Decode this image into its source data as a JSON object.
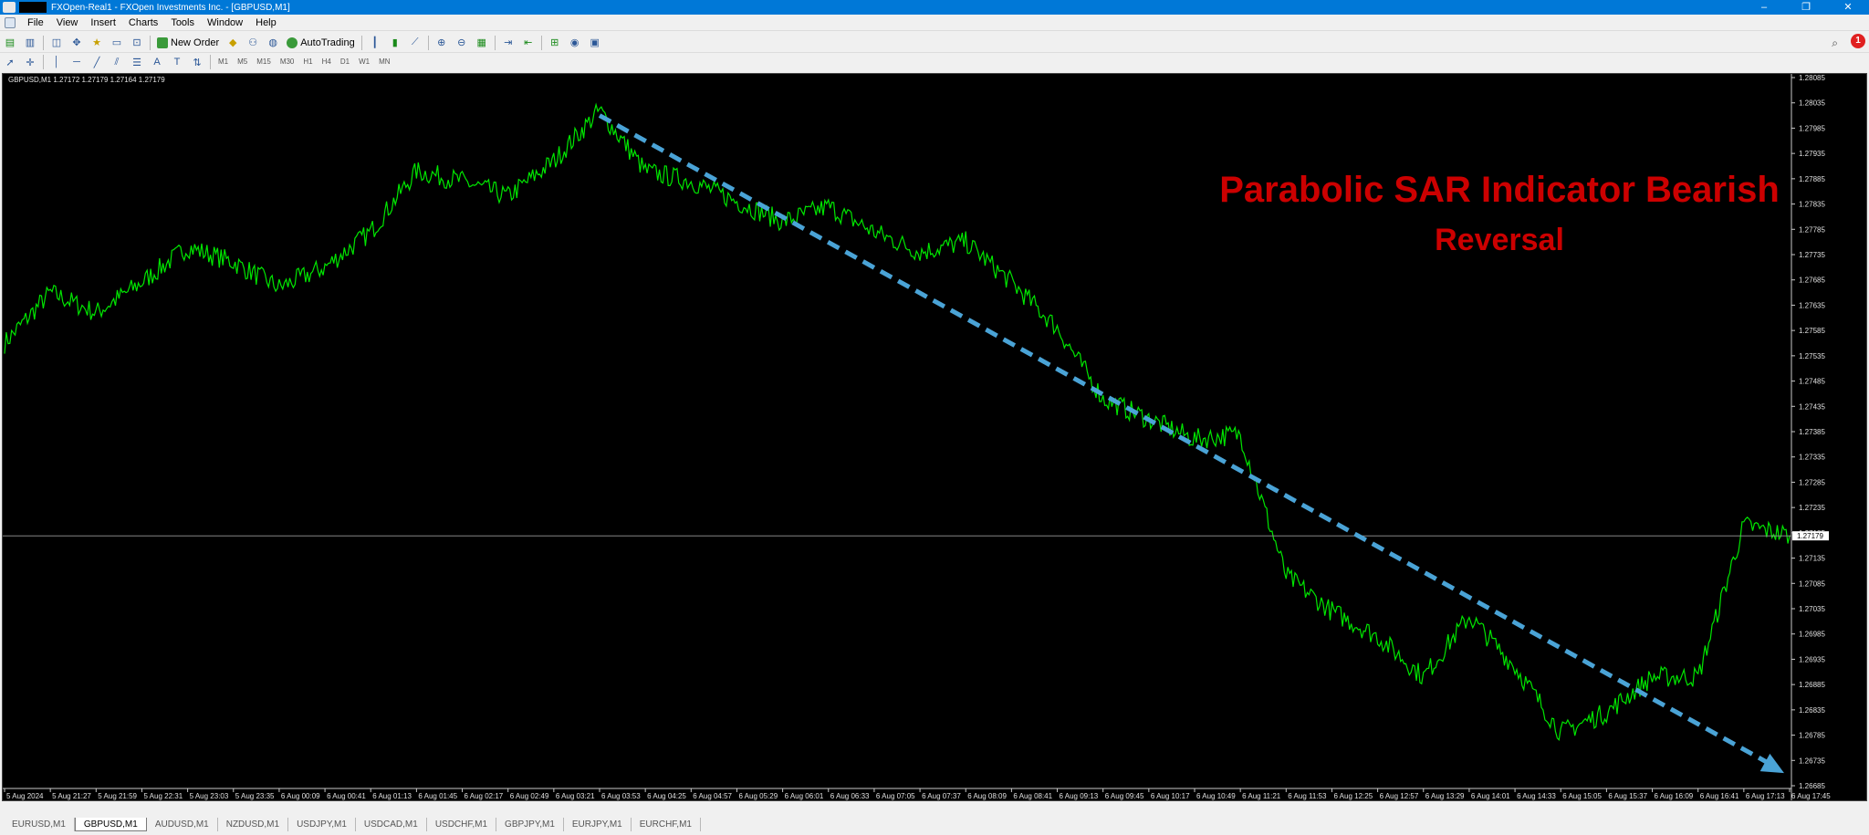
{
  "window": {
    "title": "FXOpen-Real1 - FXOpen Investments Inc. - [GBPUSD,M1]",
    "controls": [
      "–",
      "❐",
      "✕"
    ]
  },
  "menu": [
    "File",
    "View",
    "Insert",
    "Charts",
    "Tools",
    "Window",
    "Help"
  ],
  "toolbar": {
    "new_order_label": "New Order",
    "autotrading_label": "AutoTrading"
  },
  "timeframes": [
    "M1",
    "M5",
    "M15",
    "M30",
    "H1",
    "H4",
    "D1",
    "W1",
    "MN"
  ],
  "notifications": {
    "count": "1"
  },
  "chart": {
    "header": "GBPUSD,M1  1.27172 1.27179 1.27164 1.27179",
    "annotation_line1": "Parabolic SAR Indicator Bearish",
    "annotation_line2": "Reversal",
    "current_price": "1.27179",
    "colors": {
      "price_line": "#00e600",
      "trend_arrow": "#4aa3d6",
      "annotation": "#cc0000",
      "background": "#000000"
    },
    "price_ticks": [
      "1.28085",
      "1.28035",
      "1.27985",
      "1.27935",
      "1.27885",
      "1.27835",
      "1.27785",
      "1.27735",
      "1.27685",
      "1.27635",
      "1.27585",
      "1.27535",
      "1.27485",
      "1.27435",
      "1.27385",
      "1.27335",
      "1.27285",
      "1.27235",
      "1.27185",
      "1.27135",
      "1.27085",
      "1.27035",
      "1.26985",
      "1.26935",
      "1.26885",
      "1.26835",
      "1.26785",
      "1.26735",
      "1.26685"
    ],
    "time_ticks": [
      "5 Aug 2024",
      "5 Aug 21:27",
      "5 Aug 21:59",
      "5 Aug 22:31",
      "5 Aug 23:03",
      "5 Aug 23:35",
      "6 Aug 00:09",
      "6 Aug 00:41",
      "6 Aug 01:13",
      "6 Aug 01:45",
      "6 Aug 02:17",
      "6 Aug 02:49",
      "6 Aug 03:21",
      "6 Aug 03:53",
      "6 Aug 04:25",
      "6 Aug 04:57",
      "6 Aug 05:29",
      "6 Aug 06:01",
      "6 Aug 06:33",
      "6 Aug 07:05",
      "6 Aug 07:37",
      "6 Aug 08:09",
      "6 Aug 08:41",
      "6 Aug 09:13",
      "6 Aug 09:45",
      "6 Aug 10:17",
      "6 Aug 10:49",
      "6 Aug 11:21",
      "6 Aug 11:53",
      "6 Aug 12:25",
      "6 Aug 12:57",
      "6 Aug 13:29",
      "6 Aug 14:01",
      "6 Aug 14:33",
      "6 Aug 15:05",
      "6 Aug 15:37",
      "6 Aug 16:09",
      "6 Aug 16:41",
      "6 Aug 17:13",
      "6 Aug 17:45"
    ]
  },
  "chart_data": {
    "type": "line",
    "symbol": "GBPUSD",
    "timeframe": "M1",
    "x": [
      "5 Aug 2024",
      "5 Aug 21:27",
      "5 Aug 21:59",
      "5 Aug 22:31",
      "5 Aug 23:03",
      "5 Aug 23:35",
      "6 Aug 00:09",
      "6 Aug 00:41",
      "6 Aug 01:13",
      "6 Aug 01:45",
      "6 Aug 02:17",
      "6 Aug 02:49",
      "6 Aug 03:21",
      "6 Aug 03:53",
      "6 Aug 04:25",
      "6 Aug 04:57",
      "6 Aug 05:29",
      "6 Aug 06:01",
      "6 Aug 06:33",
      "6 Aug 07:05",
      "6 Aug 07:37",
      "6 Aug 08:09",
      "6 Aug 08:41",
      "6 Aug 09:13",
      "6 Aug 09:45",
      "6 Aug 10:17",
      "6 Aug 10:49",
      "6 Aug 11:21",
      "6 Aug 11:53",
      "6 Aug 12:25",
      "6 Aug 12:57",
      "6 Aug 13:29",
      "6 Aug 14:01",
      "6 Aug 14:33",
      "6 Aug 15:05",
      "6 Aug 15:37",
      "6 Aug 16:09",
      "6 Aug 16:41",
      "6 Aug 17:13",
      "6 Aug 17:45"
    ],
    "series": [
      {
        "values": [
          1.2756,
          1.2766,
          1.2762,
          1.2768,
          1.2775,
          1.2772,
          1.2767,
          1.2771,
          1.2778,
          1.279,
          1.2788,
          1.2785,
          1.2792,
          1.2802,
          1.279,
          1.2788,
          1.2784,
          1.278,
          1.2783,
          1.2778,
          1.2774,
          1.2776,
          1.2768,
          1.2759,
          1.2745,
          1.2741,
          1.2737,
          1.2738,
          1.271,
          1.2703,
          1.2698,
          1.269,
          1.2702,
          1.2692,
          1.2679,
          1.2683,
          1.269,
          1.269,
          1.272,
          1.2718
        ]
      }
    ],
    "ylim": [
      1.26685,
      1.28085
    ],
    "trendline": {
      "from": {
        "x": "6 Aug 03:53",
        "y": 1.2801
      },
      "to": {
        "x": "6 Aug 17:45",
        "y": 1.2671
      }
    }
  },
  "tabs": [
    "EURUSD,M1",
    "GBPUSD,M1",
    "AUDUSD,M1",
    "NZDUSD,M1",
    "USDJPY,M1",
    "USDCAD,M1",
    "USDCHF,M1",
    "GBPJPY,M1",
    "EURJPY,M1",
    "EURCHF,M1"
  ],
  "active_tab": "GBPUSD,M1"
}
